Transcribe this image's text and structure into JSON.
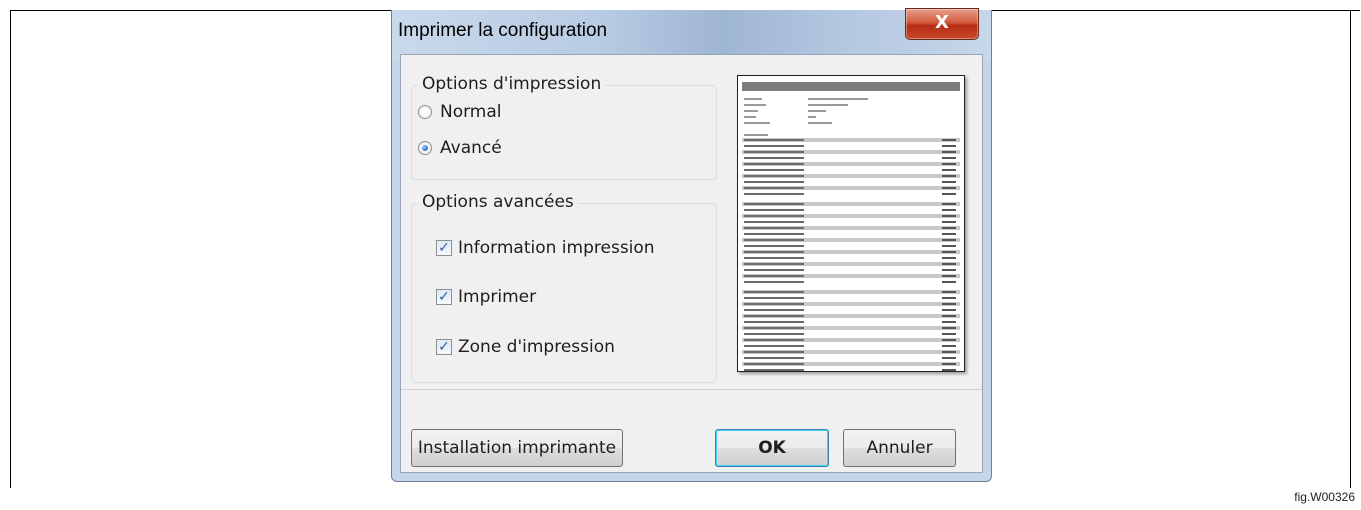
{
  "dialog": {
    "title": "Imprimer la configuration",
    "close_label": "X"
  },
  "print_options": {
    "legend": "Options d'impression",
    "radios": [
      {
        "label": "Normal",
        "selected": false
      },
      {
        "label": "Avancé",
        "selected": true
      }
    ]
  },
  "advanced_options": {
    "legend": "Options avancées",
    "checks": [
      {
        "label": "Information impression",
        "checked": true
      },
      {
        "label": "Imprimer",
        "checked": true
      },
      {
        "label": "Zone d'impression",
        "checked": true
      }
    ]
  },
  "buttons": {
    "printer_setup": "Installation imprimante",
    "ok": "OK",
    "cancel": "Annuler"
  },
  "figure_label": "fig.W00326",
  "colors": {
    "accent": "#2a6fc2",
    "close": "#c84a2c"
  }
}
